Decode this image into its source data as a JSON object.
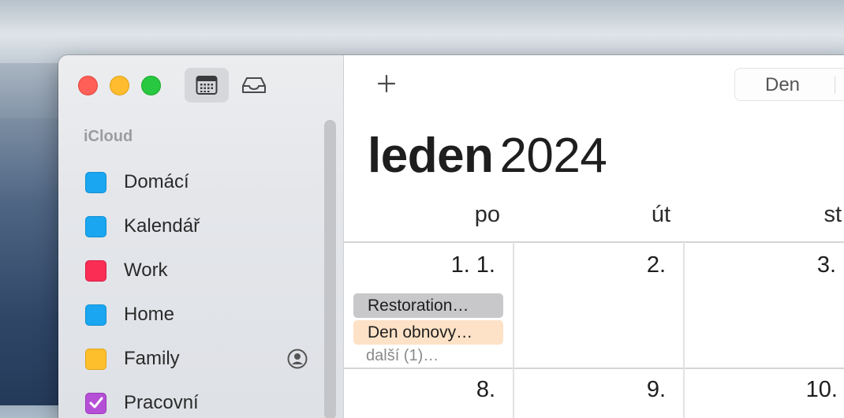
{
  "sidebar": {
    "section_title": "iCloud",
    "calendars": [
      {
        "label": "Domácí",
        "color": "#1aa6f0",
        "checked": false,
        "shared": false
      },
      {
        "label": "Kalendář",
        "color": "#1aa6f0",
        "checked": false,
        "shared": false
      },
      {
        "label": "Work",
        "color": "#fa2d55",
        "checked": false,
        "shared": false
      },
      {
        "label": "Home",
        "color": "#1aa6f0",
        "checked": false,
        "shared": false
      },
      {
        "label": "Family",
        "color": "#febf2d",
        "checked": false,
        "shared": true
      },
      {
        "label": "Pracovní",
        "color": "#b54fd6",
        "checked": true,
        "shared": false
      }
    ]
  },
  "toolbar": {
    "add_label": "+",
    "view_den": "Den"
  },
  "header": {
    "month": "leden",
    "year": "2024"
  },
  "weekdays": [
    "po",
    "út",
    "st"
  ],
  "week1": {
    "days": [
      "1. 1.",
      "2.",
      "3."
    ],
    "events": [
      {
        "title": "Restoration…",
        "color": "#c8c8ca"
      },
      {
        "title": "Den obnovy…",
        "color": "#fde2c7"
      }
    ],
    "more": "další (1)…"
  },
  "week2": {
    "days": [
      "8.",
      "9.",
      "10."
    ]
  }
}
